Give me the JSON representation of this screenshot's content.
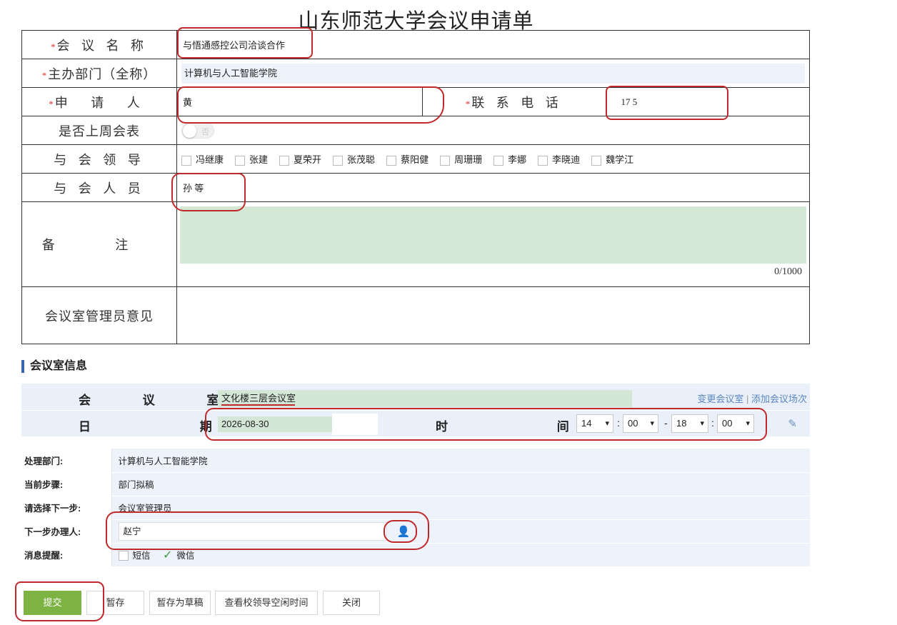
{
  "title": "山东师范大学会议申请单",
  "form": {
    "meeting_name_label": "会 议 名 称",
    "meeting_name_value": "与悟通感控公司洽谈合作",
    "host_dept_label": "主办部门（全称）",
    "host_dept_value": "计算机与人工智能学院",
    "applicant_label": "申 请 人",
    "applicant_value": "黄",
    "phone_label": "联 系 电 话",
    "phone_value": "17          5",
    "weekly_label": "是否上周会表",
    "weekly_toggle": "否",
    "leaders_label": "与 会 领 导",
    "leaders": [
      "冯继康",
      "张建",
      "夏荣开",
      "张茂聪",
      "蔡阳健",
      "周珊珊",
      "李娜",
      "李晓迪",
      "魏学江"
    ],
    "attendees_label": "与 会 人 员",
    "attendees_value": "孙   等",
    "remark_label": "备 注",
    "remark_counter": "0/1000",
    "admin_opinion_label": "会议室管理员意见",
    "required_mark": "*"
  },
  "room": {
    "section_title": "会议室信息",
    "room_label": "会 议 室",
    "room_value": "文化楼三层会议室",
    "change_link": "变更会议室",
    "separator": "|",
    "add_link": "添加会议场次",
    "date_label": "日 期",
    "date_value": "2026-08-30",
    "time_label": "时 间",
    "start_hour": "14",
    "start_min": "00",
    "dash": "-",
    "end_hour": "18",
    "end_min": "00",
    "colon": ":",
    "pencil_icon": "pencil-icon"
  },
  "flow": {
    "dept_label": "处理部门:",
    "dept_value": "计算机与人工智能学院",
    "step_label": "当前步骤:",
    "step_value": "部门拟稿",
    "next_label": "请选择下一步:",
    "next_value": "会议室管理员",
    "handler_label": "下一步办理人:",
    "handler_value": "赵宁",
    "remind_label": "消息提醒:",
    "sms_label": "短信",
    "wechat_label": "微信"
  },
  "buttons": {
    "submit": "提交",
    "save": "暂存",
    "save_draft": "暂存为草稿",
    "check_time": "查看校领导空闲时间",
    "close": "关闭"
  },
  "colors": {
    "annotation": "#c0292b",
    "primary_button": "#7cb342",
    "remark_bg": "#d5e8d6",
    "link": "#5a86c0"
  }
}
